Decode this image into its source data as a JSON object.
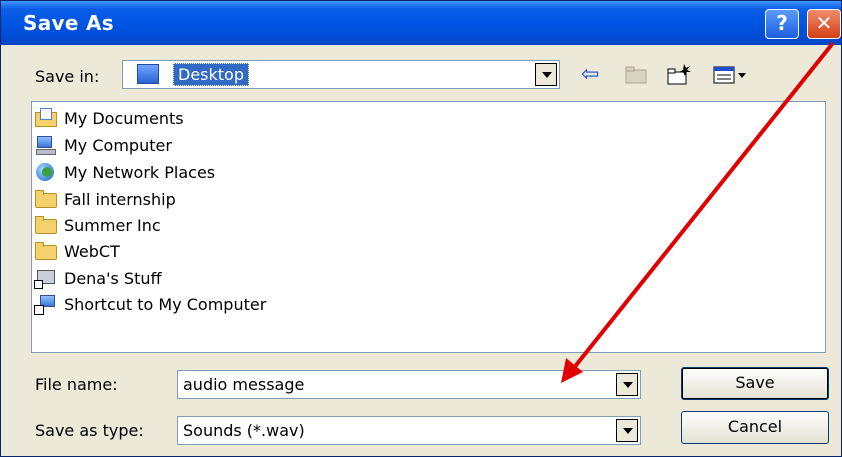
{
  "window": {
    "title": "Save As"
  },
  "titlebar": {
    "help_label": "?",
    "close_label": "✕"
  },
  "toolbar": {
    "save_in_label": "Save in:",
    "save_in_value": "Desktop",
    "back_glyph": "⇦"
  },
  "files": [
    {
      "label": "My Documents",
      "icon": "my-documents-icon"
    },
    {
      "label": "My Computer",
      "icon": "my-computer-icon"
    },
    {
      "label": "My Network Places",
      "icon": "network-places-icon"
    },
    {
      "label": "Fall internship",
      "icon": "folder-icon"
    },
    {
      "label": "Summer Inc",
      "icon": "folder-icon"
    },
    {
      "label": "WebCT",
      "icon": "folder-icon"
    },
    {
      "label": "Dena's Stuff",
      "icon": "shared-folder-icon"
    },
    {
      "label": "Shortcut to My Computer",
      "icon": "shortcut-icon"
    }
  ],
  "form": {
    "file_name_label": "File name:",
    "file_name_value": "audio message",
    "save_type_label": "Save as type:",
    "save_type_value": "Sounds (*.wav)"
  },
  "buttons": {
    "save_label": "Save",
    "cancel_label": "Cancel"
  },
  "colors": {
    "titlebar": "#0054e3",
    "selection": "#316ac5",
    "annotation_arrow": "#e00000"
  }
}
